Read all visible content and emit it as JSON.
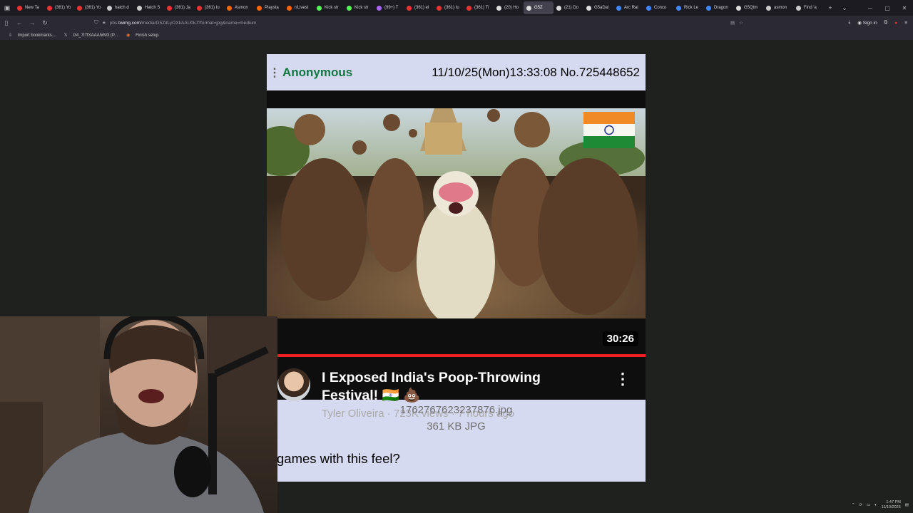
{
  "browser": {
    "tabs": [
      {
        "label": "New Ta",
        "color": "#e33"
      },
      {
        "label": "(361) Yo",
        "color": "#e33"
      },
      {
        "label": "(361) Yo",
        "color": "#e33"
      },
      {
        "label": "hatch d",
        "color": "#ccc"
      },
      {
        "label": "Hatch S",
        "color": "#ccc"
      },
      {
        "label": "(361) Ja",
        "color": "#e33"
      },
      {
        "label": "(361) Iu",
        "color": "#e33"
      },
      {
        "label": "Asmon",
        "color": "#f60"
      },
      {
        "label": "Playsta",
        "color": "#f60"
      },
      {
        "label": "r/Livest",
        "color": "#f60"
      },
      {
        "label": "Kick str",
        "color": "#5f5"
      },
      {
        "label": "Kick str",
        "color": "#5f5"
      },
      {
        "label": "(99+) T",
        "color": "#a6f"
      },
      {
        "label": "(361) el",
        "color": "#e33"
      },
      {
        "label": "(361) Iu",
        "color": "#e33"
      },
      {
        "label": "(361) Ti",
        "color": "#e33"
      },
      {
        "label": "(20) Ho",
        "color": "#ddd"
      },
      {
        "label": "G5Z",
        "color": "#ddd",
        "active": true
      },
      {
        "label": "(21) Do",
        "color": "#ddd"
      },
      {
        "label": "G5aDal",
        "color": "#ddd"
      },
      {
        "label": "Arc Rai",
        "color": "#48f"
      },
      {
        "label": "Conco",
        "color": "#48f"
      },
      {
        "label": "Rick Le",
        "color": "#48f"
      },
      {
        "label": "Dragon",
        "color": "#48f"
      },
      {
        "label": "G5Qtm",
        "color": "#ddd"
      },
      {
        "label": "asmon",
        "color": "#ccc"
      },
      {
        "label": "Find 'a",
        "color": "#ccc"
      }
    ],
    "url_scheme": "pbs.",
    "url_host": "twimg.com",
    "url_path": "/media/G5ZdLyOXkAAU0kJ?format=jpg&name=medium",
    "sign_in_label": "Sign in",
    "bookmarks": [
      "Import bookmarks...",
      "G4_7t7fXAAAhrM3 (P..."
    ],
    "finish_setup_label": "Finish setup"
  },
  "post": {
    "name": "Anonymous",
    "meta": "11/10/25(Mon)13:33:08 No.725448652",
    "video": {
      "duration": "30:26",
      "title_line1": "I Exposed India's Poop-Throwing",
      "title_line2": "Festival! 🇮🇳 💩",
      "channel_info": "Tyler Oliveira · 723K views · 7 hours ago"
    },
    "file_name": "1762767623237876.jpg",
    "file_size": "361 KB JPG",
    "comment": "games with this feel?"
  },
  "taskbar": {
    "time": "1:47 PM",
    "date": "11/10/2025"
  }
}
